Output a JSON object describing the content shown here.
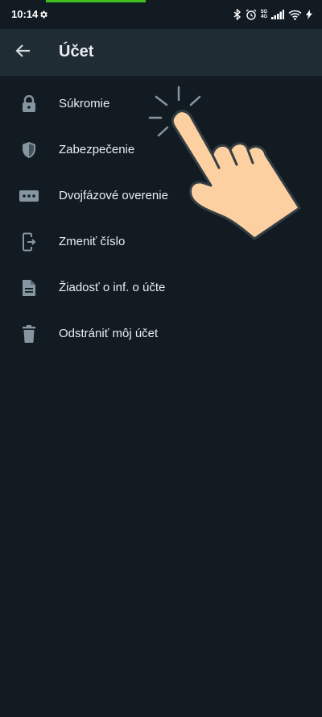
{
  "status_bar": {
    "time": "10:14",
    "network_top": "5G",
    "network_bottom": "4G",
    "progress_fraction": 0.31
  },
  "header": {
    "title": "Účet"
  },
  "menu": {
    "items": [
      {
        "label": "Súkromie",
        "icon": "lock-icon"
      },
      {
        "label": "Zabezpečenie",
        "icon": "shield-icon"
      },
      {
        "label": "Dvojfázové overenie",
        "icon": "dots-icon"
      },
      {
        "label": "Zmeniť číslo",
        "icon": "change-number-icon"
      },
      {
        "label": "Žiadosť o inf. o účte",
        "icon": "document-icon"
      },
      {
        "label": "Odstrániť môj účet",
        "icon": "trash-icon"
      }
    ]
  },
  "colors": {
    "background": "#121b22",
    "app_bar": "#1f2c34",
    "icon": "#8696a0",
    "text": "#e9edef",
    "progress": "#3fbf1f"
  }
}
